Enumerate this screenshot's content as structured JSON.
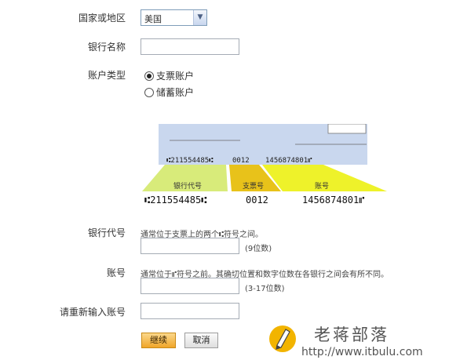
{
  "form": {
    "country": {
      "label": "国家或地区",
      "value": "美国"
    },
    "bank_name": {
      "label": "银行名称",
      "value": ""
    },
    "account_type": {
      "label": "账户类型",
      "options": [
        {
          "label": "支票账户",
          "selected": true
        },
        {
          "label": "储蓄账户",
          "selected": false
        }
      ]
    },
    "routing": {
      "label": "银行代号",
      "hint": "通常位于支票上的两个⑆符号之间。",
      "suffix": "(9位数)",
      "value": ""
    },
    "account": {
      "label": "账号",
      "hint": "通常位于⑈符号之前。其确切位置和数字位数在各银行之间会有所不同。",
      "suffix": "(3-17位数)",
      "value": ""
    },
    "account_confirm": {
      "label": "请重新输入账号",
      "value": ""
    }
  },
  "check_diagram": {
    "micr_small": [
      "⑆211554485⑆",
      "0012",
      "1456874801⑈"
    ],
    "tabs": [
      "银行代号",
      "支票号",
      "账号"
    ],
    "micr_large": [
      "⑆211554485⑆",
      "0012",
      "1456874801⑈"
    ],
    "colors": {
      "routing": "#d8eb7a",
      "check": "#e8c21a",
      "account": "#eef22a",
      "check_bg": "#c9d7ee"
    }
  },
  "buttons": {
    "continue": "继续",
    "cancel": "取消"
  },
  "watermark": {
    "title": "老蒋部落",
    "url": "http://www.itbulu.com"
  }
}
